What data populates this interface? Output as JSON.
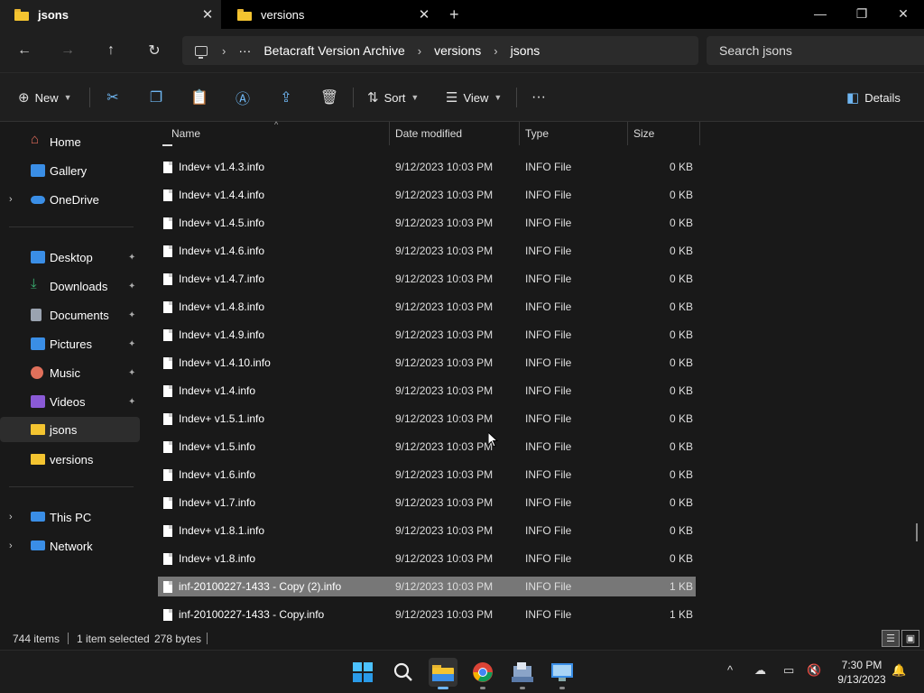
{
  "tabs": [
    {
      "label": "jsons",
      "close": "✕"
    },
    {
      "label": "versions",
      "close": "✕"
    }
  ],
  "new_tab": "+",
  "window_controls": {
    "minimize": "—",
    "restore": "❐",
    "close": "✕"
  },
  "nav": {
    "back": "←",
    "forward": "→",
    "up": "↑",
    "refresh": "↻"
  },
  "address": {
    "ellipsis": "···",
    "crumbs": [
      "Betacraft Version Archive",
      "versions",
      "jsons"
    ],
    "separator": "›"
  },
  "search": {
    "placeholder": "Search jsons"
  },
  "commands": {
    "new": "New",
    "sort": "Sort",
    "view": "View",
    "more": "···",
    "details": "Details"
  },
  "icons": {
    "cut": "scissors-icon",
    "copy": "copy-icon",
    "paste": "clipboard-icon",
    "rename": "rename-icon",
    "share": "share-icon",
    "delete": "trash-icon"
  },
  "sidebar": {
    "quick": [
      {
        "label": "Home",
        "color": "#e06b5b"
      },
      {
        "label": "Gallery",
        "color": "#3a8ee6"
      },
      {
        "label": "OneDrive",
        "color": "#3a8ee6",
        "expander": "›"
      }
    ],
    "pinned": [
      {
        "label": "Desktop",
        "color": "#3a8ee6",
        "pin": "📌"
      },
      {
        "label": "Downloads",
        "color": "#3bb273",
        "pin": "📌"
      },
      {
        "label": "Documents",
        "color": "#9aa3b0",
        "pin": "📌"
      },
      {
        "label": "Pictures",
        "color": "#3a8ee6",
        "pin": "📌"
      },
      {
        "label": "Music",
        "color": "#e0705b",
        "pin": "📌"
      },
      {
        "label": "Videos",
        "color": "#8a5ad6",
        "pin": "📌"
      },
      {
        "label": "jsons",
        "color": "#f4c430"
      },
      {
        "label": "versions",
        "color": "#f4c430"
      }
    ],
    "devices": [
      {
        "label": "This PC",
        "color": "#3a8ee6",
        "expander": "›"
      },
      {
        "label": "Network",
        "color": "#3a8ee6",
        "expander": "›"
      }
    ]
  },
  "columns": {
    "name": "Name",
    "date": "Date modified",
    "type": "Type",
    "size": "Size",
    "sort_caret": "^"
  },
  "files": [
    {
      "name": "Indev+ v1.4.3.info",
      "date": "9/12/2023 10:03 PM",
      "type": "INFO File",
      "size": "0 KB"
    },
    {
      "name": "Indev+ v1.4.4.info",
      "date": "9/12/2023 10:03 PM",
      "type": "INFO File",
      "size": "0 KB"
    },
    {
      "name": "Indev+ v1.4.5.info",
      "date": "9/12/2023 10:03 PM",
      "type": "INFO File",
      "size": "0 KB"
    },
    {
      "name": "Indev+ v1.4.6.info",
      "date": "9/12/2023 10:03 PM",
      "type": "INFO File",
      "size": "0 KB"
    },
    {
      "name": "Indev+ v1.4.7.info",
      "date": "9/12/2023 10:03 PM",
      "type": "INFO File",
      "size": "0 KB"
    },
    {
      "name": "Indev+ v1.4.8.info",
      "date": "9/12/2023 10:03 PM",
      "type": "INFO File",
      "size": "0 KB"
    },
    {
      "name": "Indev+ v1.4.9.info",
      "date": "9/12/2023 10:03 PM",
      "type": "INFO File",
      "size": "0 KB"
    },
    {
      "name": "Indev+ v1.4.10.info",
      "date": "9/12/2023 10:03 PM",
      "type": "INFO File",
      "size": "0 KB"
    },
    {
      "name": "Indev+ v1.4.info",
      "date": "9/12/2023 10:03 PM",
      "type": "INFO File",
      "size": "0 KB"
    },
    {
      "name": "Indev+ v1.5.1.info",
      "date": "9/12/2023 10:03 PM",
      "type": "INFO File",
      "size": "0 KB"
    },
    {
      "name": "Indev+ v1.5.info",
      "date": "9/12/2023 10:03 PM",
      "type": "INFO File",
      "size": "0 KB"
    },
    {
      "name": "Indev+ v1.6.info",
      "date": "9/12/2023 10:03 PM",
      "type": "INFO File",
      "size": "0 KB"
    },
    {
      "name": "Indev+ v1.7.info",
      "date": "9/12/2023 10:03 PM",
      "type": "INFO File",
      "size": "0 KB"
    },
    {
      "name": "Indev+ v1.8.1.info",
      "date": "9/12/2023 10:03 PM",
      "type": "INFO File",
      "size": "0 KB"
    },
    {
      "name": "Indev+ v1.8.info",
      "date": "9/12/2023 10:03 PM",
      "type": "INFO File",
      "size": "0 KB"
    },
    {
      "name": "inf-20100227-1433 - Copy (2).info",
      "date": "9/12/2023 10:03 PM",
      "type": "INFO File",
      "size": "1 KB",
      "selected": true
    },
    {
      "name": "inf-20100227-1433 - Copy.info",
      "date": "9/12/2023 10:03 PM",
      "type": "INFO File",
      "size": "1 KB"
    }
  ],
  "status": {
    "count": "744 items",
    "selection": "1 item selected",
    "size": "278 bytes"
  },
  "taskbar": {
    "apps": [
      "start-icon",
      "search-icon",
      "file-explorer-icon",
      "chrome-icon",
      "app-icon",
      "app-icon-2"
    ],
    "tray": {
      "chevron": "^"
    },
    "time": "7:30 PM",
    "date": "9/13/2023"
  },
  "colors": {
    "accent": "#6fb6f2",
    "selected_row": "#777777",
    "folder": "#f4c430"
  }
}
